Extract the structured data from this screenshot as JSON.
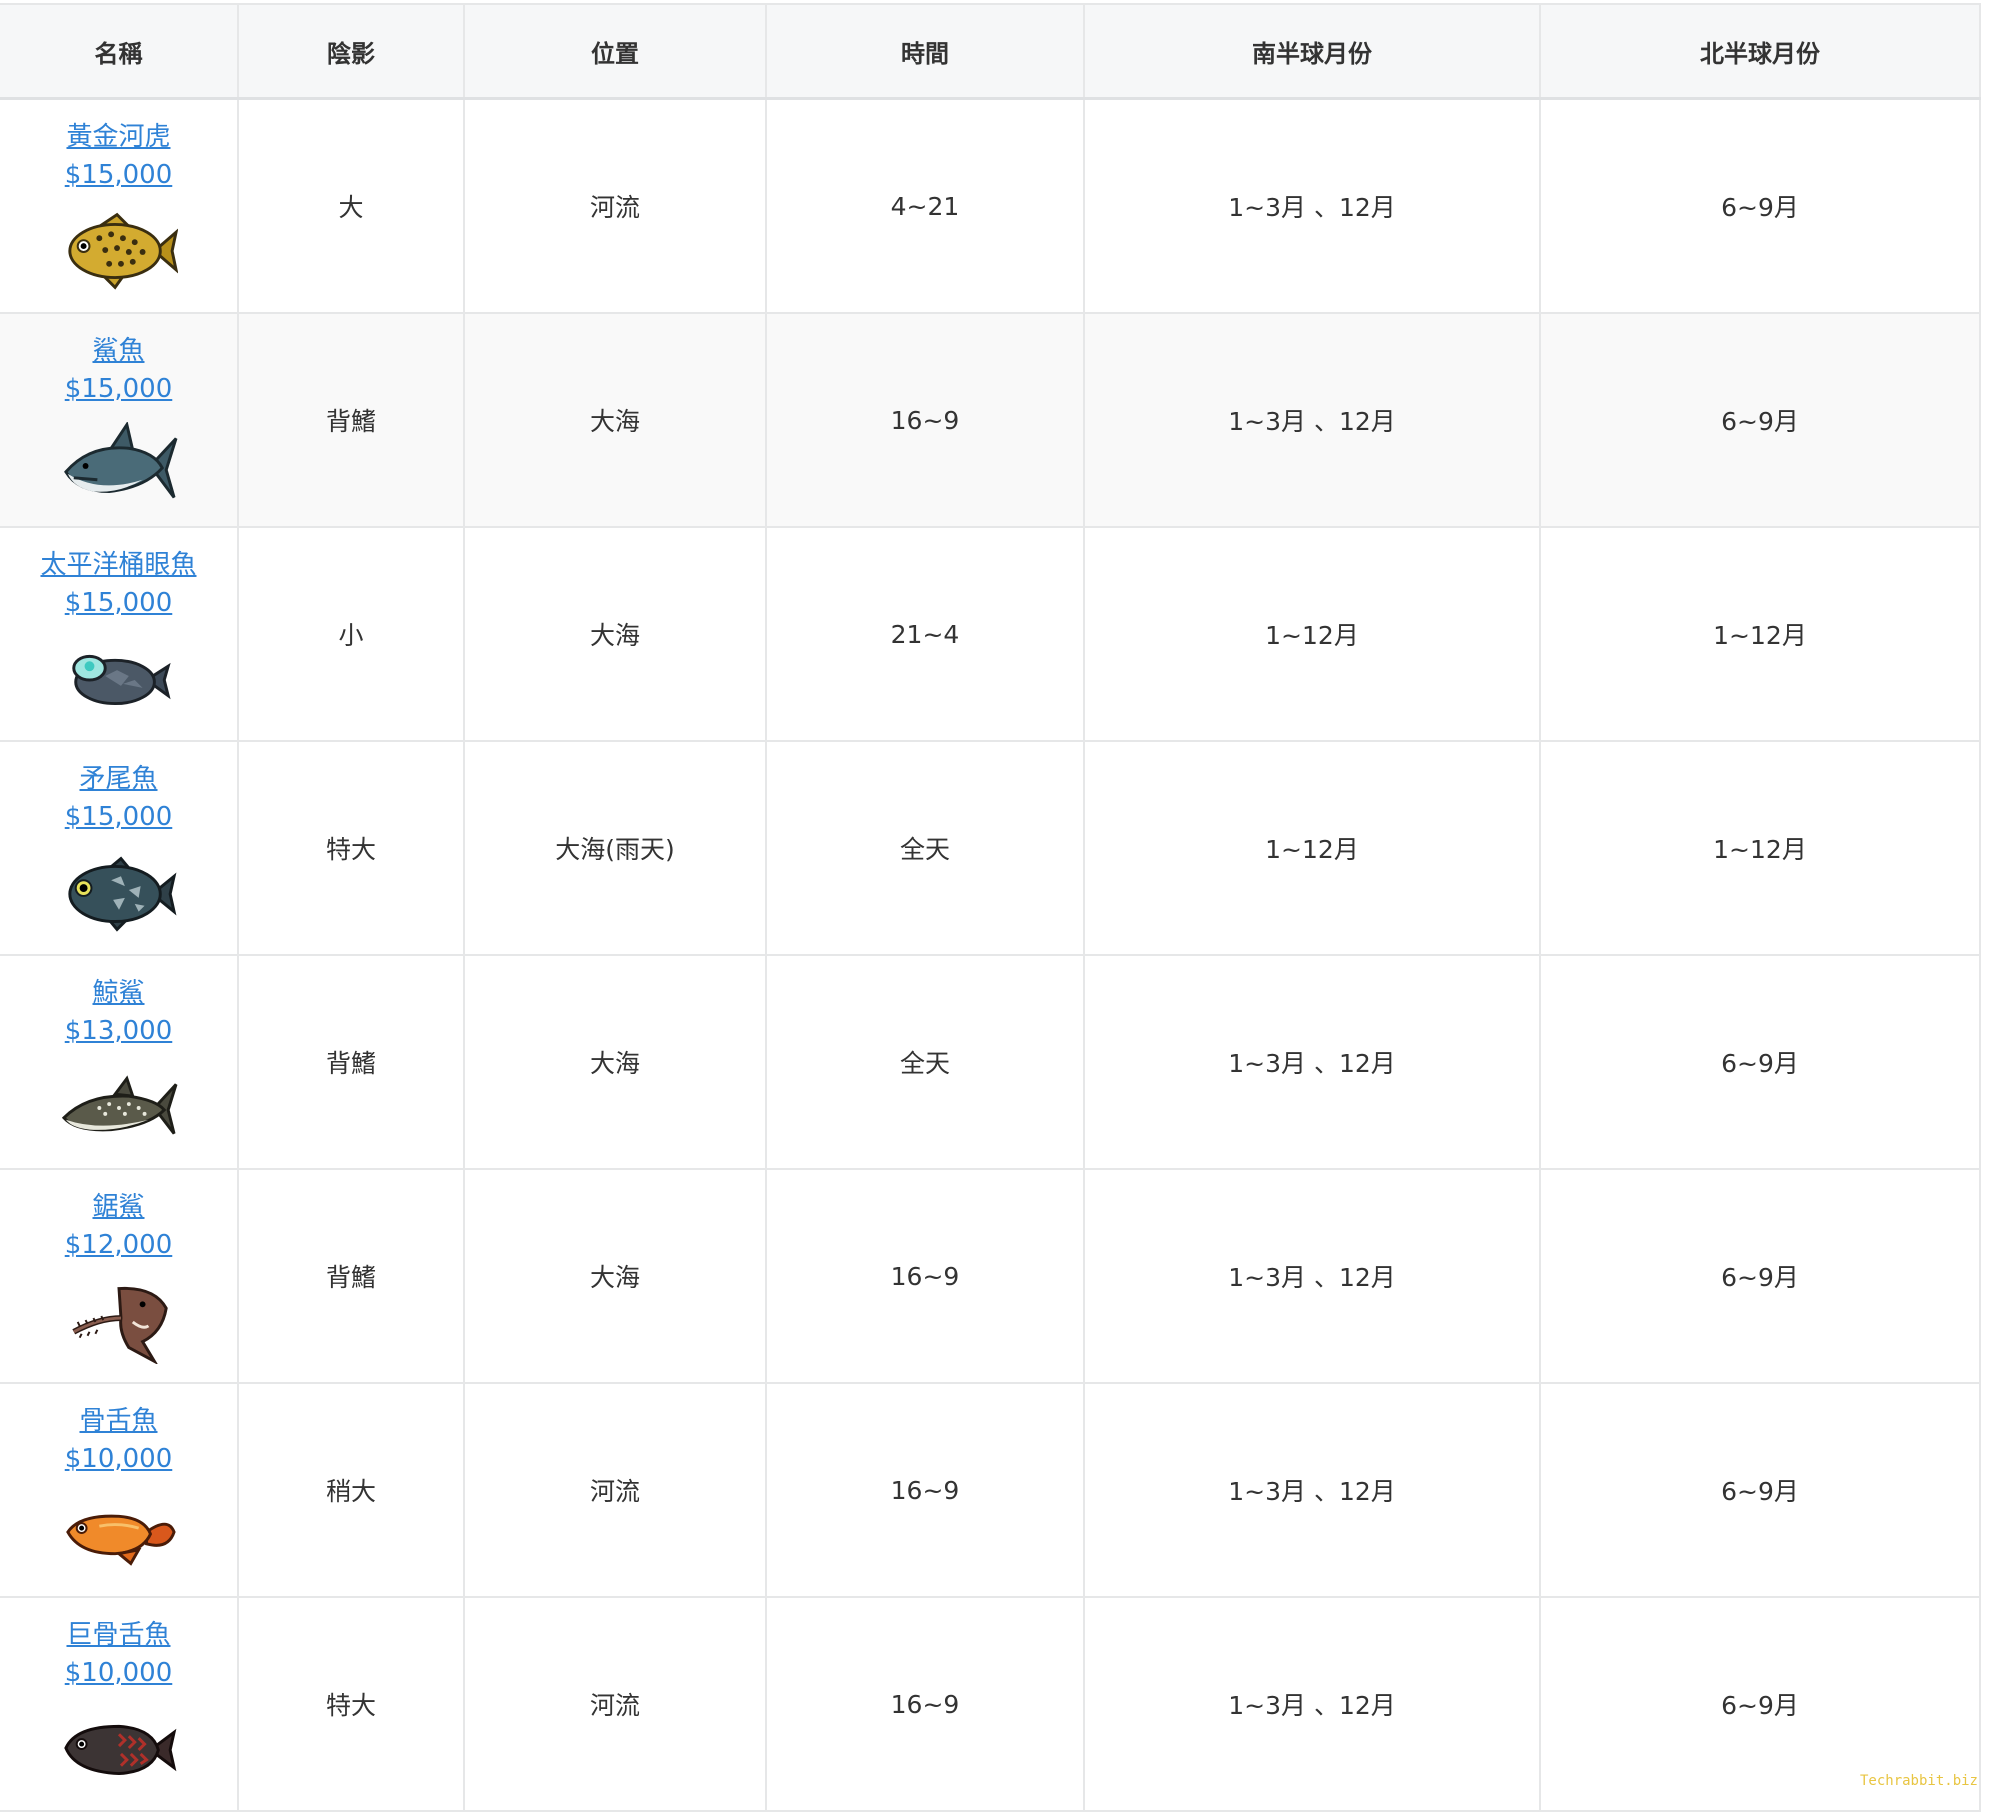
{
  "headers": [
    "名稱",
    "陰影",
    "位置",
    "時間",
    "南半球月份",
    "北半球月份"
  ],
  "rows": [
    {
      "name": "黃金河虎",
      "price": "$15,000",
      "shadow": "大",
      "location": "河流",
      "time": "4~21",
      "south": "1~3月 、12月",
      "north": "6~9月",
      "icon": "golden-trout-icon"
    },
    {
      "name": "鯊魚",
      "price": "$15,000",
      "shadow": "背鰭",
      "location": "大海",
      "time": "16~9",
      "south": "1~3月 、12月",
      "north": "6~9月",
      "icon": "shark-icon"
    },
    {
      "name": "太平洋桶眼魚",
      "price": "$15,000",
      "shadow": "小",
      "location": "大海",
      "time": "21~4",
      "south": "1~12月",
      "north": "1~12月",
      "icon": "barreleye-icon"
    },
    {
      "name": "矛尾魚",
      "price": "$15,000",
      "shadow": "特大",
      "location": "大海(雨天)",
      "time": "全天",
      "south": "1~12月",
      "north": "1~12月",
      "icon": "coelacanth-icon"
    },
    {
      "name": "鯨鯊",
      "price": "$13,000",
      "shadow": "背鰭",
      "location": "大海",
      "time": "全天",
      "south": "1~3月 、12月",
      "north": "6~9月",
      "icon": "whale-shark-icon"
    },
    {
      "name": "鋸鯊",
      "price": "$12,000",
      "shadow": "背鰭",
      "location": "大海",
      "time": "16~9",
      "south": "1~3月 、12月",
      "north": "6~9月",
      "icon": "saw-shark-icon"
    },
    {
      "name": "骨舌魚",
      "price": "$10,000",
      "shadow": "稍大",
      "location": "河流",
      "time": "16~9",
      "south": "1~3月 、12月",
      "north": "6~9月",
      "icon": "arowana-icon"
    },
    {
      "name": "巨骨舌魚",
      "price": "$10,000",
      "shadow": "特大",
      "location": "河流",
      "time": "16~9",
      "south": "1~3月 、12月",
      "north": "6~9月",
      "icon": "arapaima-icon"
    }
  ],
  "watermark": "Techrabbit.biz"
}
